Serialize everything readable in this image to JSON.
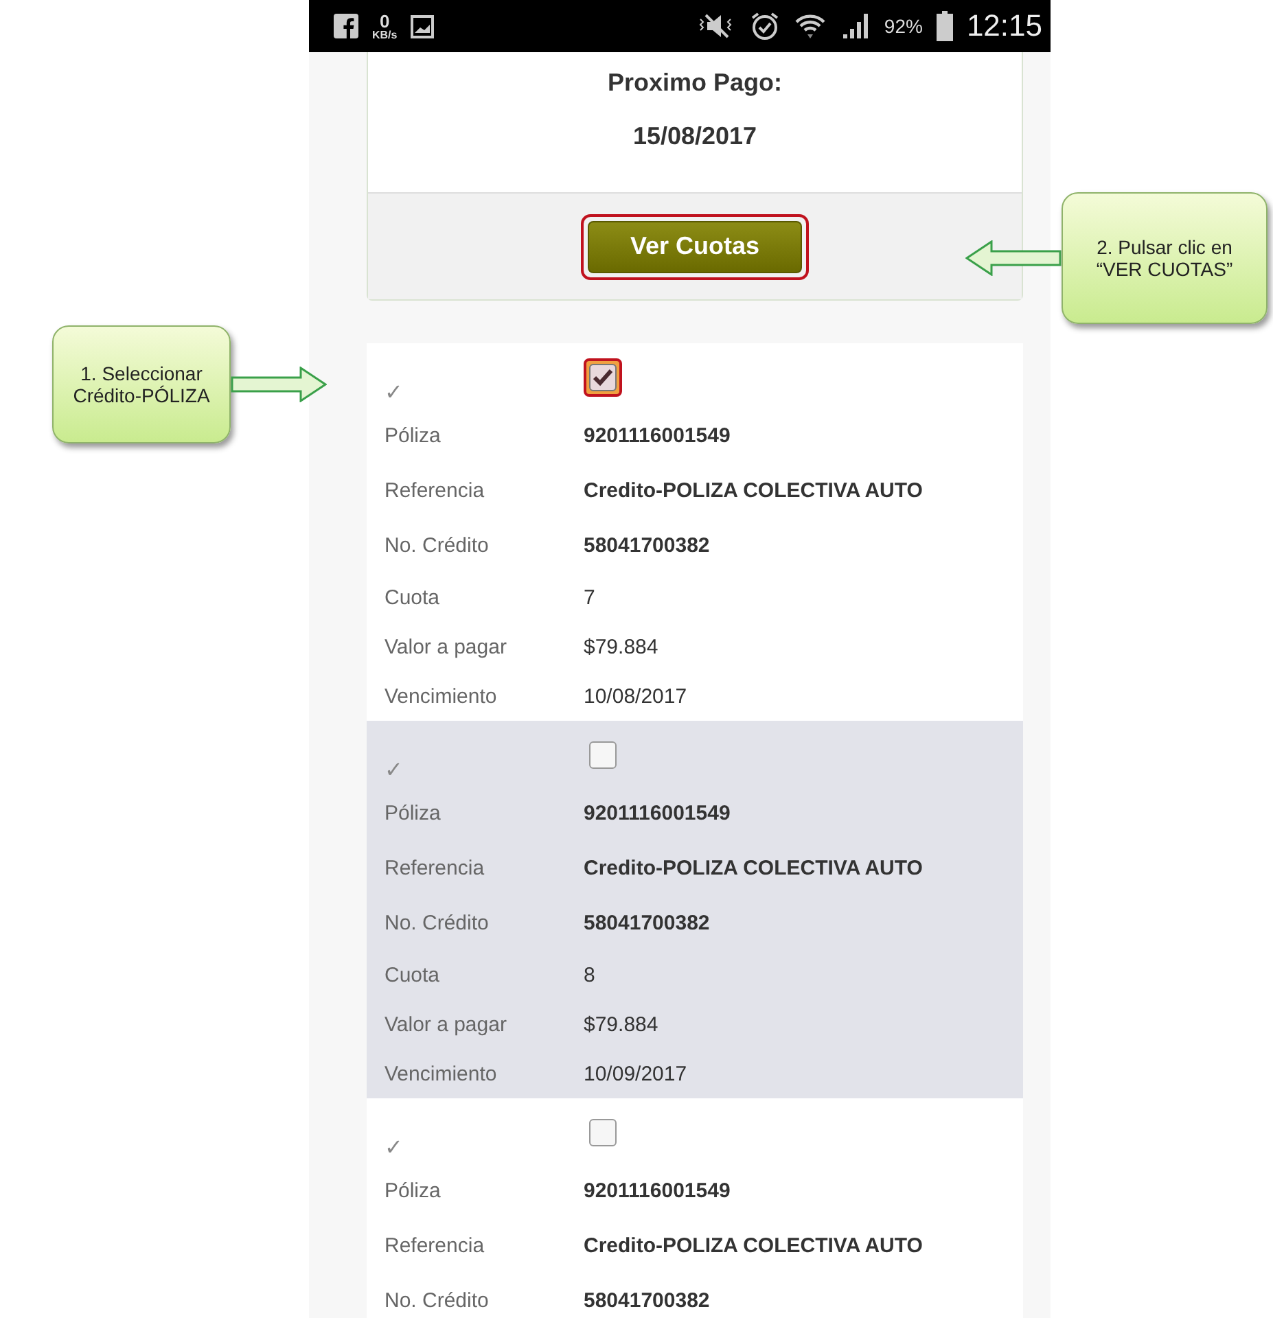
{
  "status_bar": {
    "speed": "0",
    "speed_unit": "KB/s",
    "battery": "92%",
    "time": "12:15"
  },
  "card": {
    "title": "Proximo Pago:",
    "date": "15/08/2017",
    "button": {
      "label": "Ver Cuotas",
      "annotated": true
    }
  },
  "items": [
    {
      "tick": "✓",
      "checked": true,
      "annotated": true,
      "highlighted": false,
      "fields": [
        {
          "label": "Póliza",
          "value": "9201116001549",
          "kind": "strong"
        },
        {
          "label": "Referencia",
          "value": "Credito-POLIZA COLECTIVA AUTO",
          "kind": "strong"
        },
        {
          "label": "No. Crédito",
          "value": "58041700382",
          "kind": "strong"
        },
        {
          "label": "Cuota",
          "value": "7",
          "kind": "plain"
        },
        {
          "label": "Valor a pagar",
          "value": "$79.884",
          "kind": "plain"
        },
        {
          "label": "Vencimiento",
          "value": "10/08/2017",
          "kind": "plain"
        }
      ]
    },
    {
      "tick": "✓",
      "checked": false,
      "annotated": false,
      "highlighted": true,
      "fields": [
        {
          "label": "Póliza",
          "value": "9201116001549",
          "kind": "strong"
        },
        {
          "label": "Referencia",
          "value": "Credito-POLIZA COLECTIVA AUTO",
          "kind": "strong"
        },
        {
          "label": "No. Crédito",
          "value": "58041700382",
          "kind": "strong"
        },
        {
          "label": "Cuota",
          "value": "8",
          "kind": "plain"
        },
        {
          "label": "Valor a pagar",
          "value": "$79.884",
          "kind": "plain"
        },
        {
          "label": "Vencimiento",
          "value": "10/09/2017",
          "kind": "plain"
        }
      ]
    },
    {
      "tick": "✓",
      "checked": false,
      "annotated": false,
      "highlighted": false,
      "fields": [
        {
          "label": "Póliza",
          "value": "9201116001549",
          "kind": "strong"
        },
        {
          "label": "Referencia",
          "value": "Credito-POLIZA COLECTIVA AUTO",
          "kind": "strong"
        },
        {
          "label": "No. Crédito",
          "value": "58041700382",
          "kind": "strong"
        }
      ]
    }
  ],
  "callouts": [
    {
      "text": "1. Seleccionar\nCrédito-PÓLIZA",
      "kind": "left"
    },
    {
      "text": "2. Pulsar clic en\n“VER  CUOTAS”",
      "kind": "right"
    }
  ]
}
